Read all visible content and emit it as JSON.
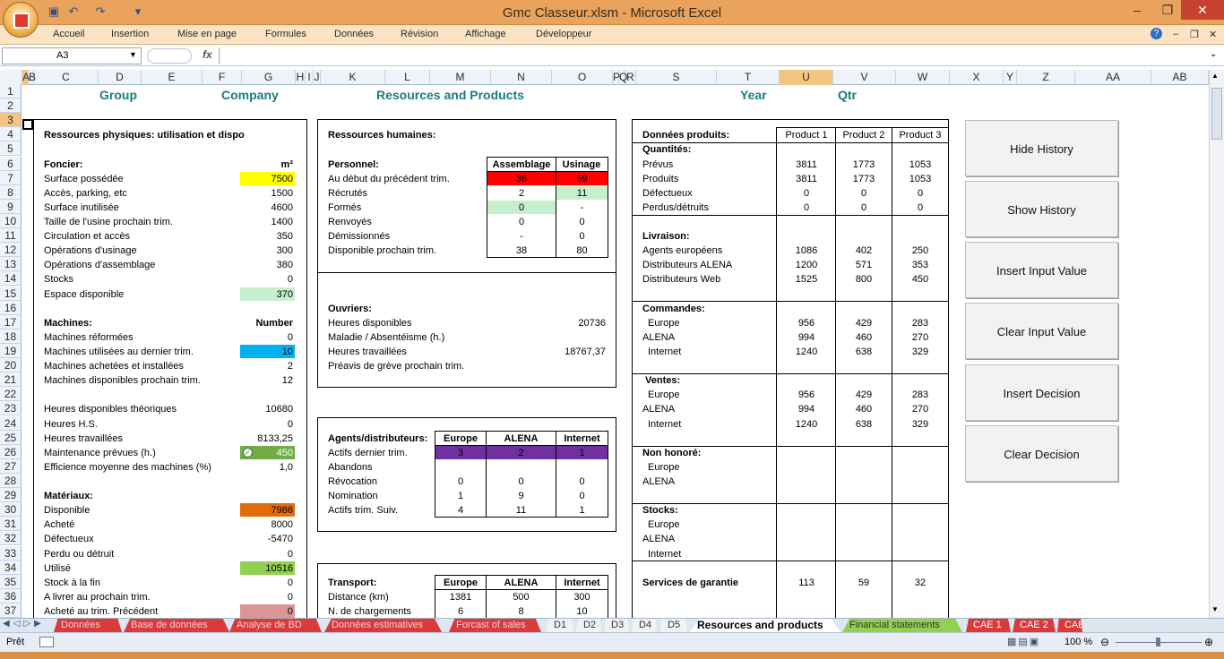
{
  "window": {
    "title": "Gmc Classeur.xlsm - Microsoft Excel"
  },
  "ribbon": {
    "tabs": [
      "Accueil",
      "Insertion",
      "Mise en page",
      "Formules",
      "Données",
      "Révision",
      "Affichage",
      "Développeur"
    ]
  },
  "formula_bar": {
    "name_box": "A3",
    "fx": "fx",
    "content": ""
  },
  "columns": [
    "A",
    "B",
    "C",
    "D",
    "E",
    "F",
    "G",
    "H",
    "I",
    "J",
    "K",
    "L",
    "M",
    "N",
    "O",
    "P",
    "Q",
    "R",
    "S",
    "T",
    "U",
    "V",
    "W",
    "X",
    "Y",
    "Z",
    "AA",
    "AB"
  ],
  "rows": [
    "1",
    "2",
    "3",
    "4",
    "5",
    "6",
    "7",
    "8",
    "9",
    "10",
    "11",
    "12",
    "13",
    "14",
    "15",
    "16",
    "17",
    "18",
    "19",
    "20",
    "21",
    "22",
    "23",
    "24",
    "25",
    "26",
    "27",
    "28",
    "29",
    "30",
    "31",
    "32",
    "33",
    "34",
    "35",
    "36",
    "37"
  ],
  "header": {
    "group": "Group",
    "company": "Company",
    "resources": "Resources and Products",
    "year": "Year",
    "qtr": "Qtr"
  },
  "physical": {
    "title": "Ressources physiques:  utilisation et dispo",
    "foncier": "Foncier:",
    "m2": "m²",
    "items": [
      [
        "Surface possédée",
        "7500"
      ],
      [
        "Accès, parking, etc",
        "1500"
      ],
      [
        "Surface inutilisée",
        "4600"
      ],
      [
        "Taille de l'usine prochain trim.",
        "1400"
      ],
      [
        "Circulation et accès",
        "350"
      ],
      [
        "Opérations d'usinage",
        "300"
      ],
      [
        "Opérations d'assemblage",
        "380"
      ],
      [
        "Stocks",
        "0"
      ],
      [
        "Espace disponible",
        "370"
      ]
    ],
    "machines": "Machines:",
    "number": "Number",
    "machine_items": [
      [
        "Machines réformées",
        "0"
      ],
      [
        "Machines utilisées au dernier trim.",
        "10"
      ],
      [
        "Machines achetées et installées",
        "2"
      ],
      [
        "Machines disponibles prochain trim.",
        "12"
      ]
    ],
    "hours_items": [
      [
        "Heures disponibles théoriques",
        "10680"
      ],
      [
        "Heures H.S.",
        "0"
      ],
      [
        "Heures travaillées",
        "8133,25"
      ],
      [
        "Maintenance prévues (h.)",
        "450"
      ],
      [
        "Efficience moyenne des machines (%)",
        "1,0"
      ]
    ],
    "materiaux": "Matériaux:",
    "mat_items": [
      [
        "Disponible",
        "7986"
      ],
      [
        "Acheté",
        "8000"
      ],
      [
        "Défectueux",
        "-5470"
      ],
      [
        "Perdu ou détruit",
        "0"
      ],
      [
        "Utilisé",
        "10516"
      ],
      [
        "Stock à la fin",
        "0"
      ],
      [
        "A livrer au prochain trim.",
        "0"
      ],
      [
        "Acheté au trim. Précédent",
        "0"
      ]
    ]
  },
  "human": {
    "title": "Ressources humaines:",
    "personnel": "Personnel:",
    "col1": "Assemblage",
    "col2": "Usinage",
    "rows": [
      [
        "Au début du précédent trim.",
        "36",
        "69"
      ],
      [
        "Récrutés",
        "2",
        "11"
      ],
      [
        "Formés",
        "0",
        "-"
      ],
      [
        "Renvoyés",
        "0",
        "0"
      ],
      [
        "Démissionnés",
        "-",
        "0"
      ],
      [
        "Disponible prochain trim.",
        "38",
        "80"
      ]
    ],
    "ouvriers": "Ouvriers:",
    "ouv_rows": [
      [
        "Heures disponibles",
        "20736"
      ],
      [
        "Maladie / Absentéisme (h.)",
        ""
      ],
      [
        "Heures travaillées",
        "18767,37"
      ]
    ],
    "strike": "Préavis de grève prochain trim."
  },
  "agents": {
    "title": "Agents/distributeurs:",
    "cols": [
      "Europe",
      "ALENA",
      "Internet"
    ],
    "rows": [
      [
        "Actifs dernier trim.",
        "3",
        "2",
        "1"
      ],
      [
        "Abandons",
        "",
        "",
        ""
      ],
      [
        "Révocation",
        "0",
        "0",
        "0"
      ],
      [
        "Nomination",
        "1",
        "9",
        "0"
      ],
      [
        "Actifs trim. Suiv.",
        "4",
        "11",
        "1"
      ]
    ]
  },
  "transport": {
    "title": "Transport:",
    "cols": [
      "Europe",
      "ALENA",
      "Internet"
    ],
    "rows": [
      [
        "Distance (km)",
        "1381",
        "500",
        "300"
      ],
      [
        "N. de chargements",
        "6",
        "8",
        "10"
      ]
    ]
  },
  "products": {
    "title": "Données produits:",
    "cols": [
      "Product 1",
      "Product 2",
      "Product 3"
    ],
    "quantites": "Quantités:",
    "q_rows": [
      [
        "Prévus",
        "3811",
        "1773",
        "1053"
      ],
      [
        "Produits",
        "3811",
        "1773",
        "1053"
      ],
      [
        "Défectueux",
        "0",
        "0",
        "0"
      ],
      [
        "Perdus/détruits",
        "0",
        "0",
        "0"
      ]
    ],
    "livraison": "Livraison:",
    "l_rows": [
      [
        "Agents européens",
        "1086",
        "402",
        "250"
      ],
      [
        "Distributeurs ALENA",
        "1200",
        "571",
        "353"
      ],
      [
        "Distributeurs Web",
        "1525",
        "800",
        "450"
      ]
    ],
    "commandes": "Commandes:",
    "c_rows": [
      [
        "Europe",
        "956",
        "429",
        "283"
      ],
      [
        "ALENA",
        "994",
        "460",
        "270"
      ],
      [
        "Internet",
        "1240",
        "638",
        "329"
      ]
    ],
    "ventes": "Ventes:",
    "v_rows": [
      [
        "Europe",
        "956",
        "429",
        "283"
      ],
      [
        "ALENA",
        "994",
        "460",
        "270"
      ],
      [
        "Internet",
        "1240",
        "638",
        "329"
      ]
    ],
    "non_honore": "Non honoré:",
    "nh_rows": [
      "Europe",
      "ALENA"
    ],
    "stocks": "Stocks:",
    "s_rows": [
      "Europe",
      "ALENA",
      "Internet"
    ],
    "garantie": "Services de garantie",
    "g_vals": [
      "113",
      "59",
      "32"
    ]
  },
  "buttons": [
    "Hide History",
    "Show History",
    "Insert Input Value",
    "Clear Input Value",
    "Insert Decision",
    "Clear Decision"
  ],
  "sheet_tabs": [
    "Données",
    "Base de données",
    "Analyse de BD",
    "Données estimatives",
    "Forcast of sales",
    "D1",
    "D2",
    "D3",
    "D4",
    "D5",
    "Resources and products",
    "Financial statements",
    "CAE 1",
    "CAE 2",
    "CAE"
  ],
  "status": {
    "ready": "Prêt",
    "zoom": "100 %"
  },
  "colors": {
    "yellow": "#ffff00",
    "green_light": "#c6efce",
    "blue": "#00b0f0",
    "green": "#70ad47",
    "orange": "#e26b0a",
    "pink": "#da9694",
    "red": "#ff0000",
    "purple": "#7030a0",
    "teal": "#1a7c7c"
  }
}
